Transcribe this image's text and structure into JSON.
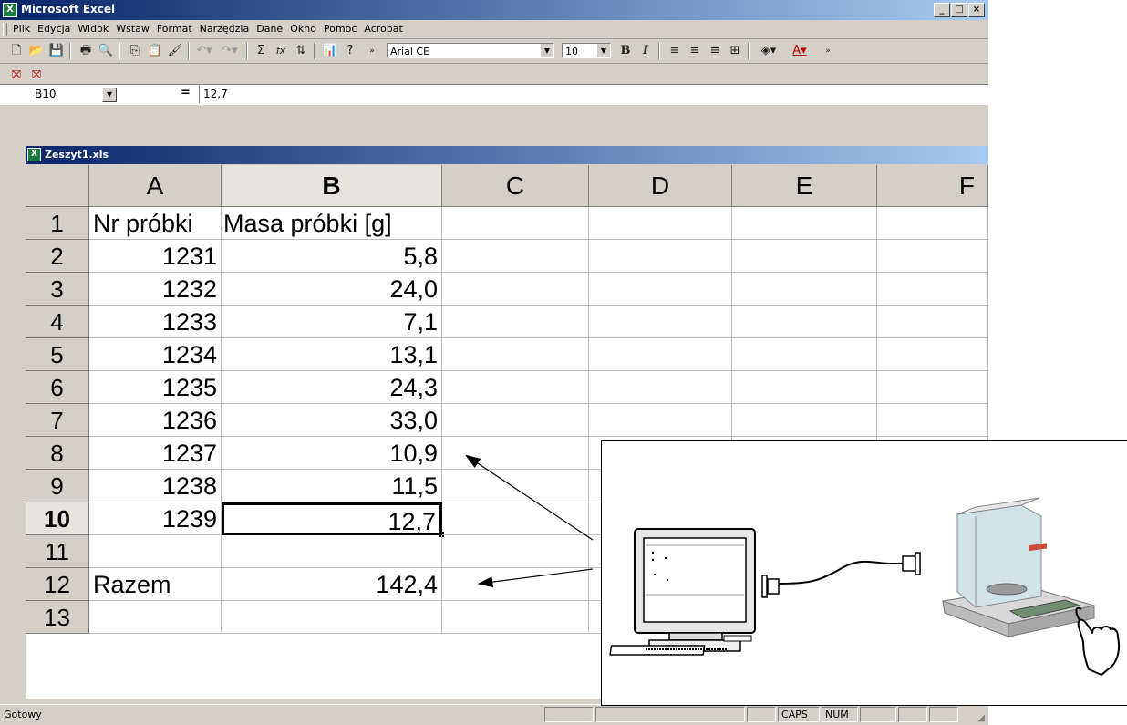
{
  "window": {
    "title": "Microsoft Excel",
    "buttons": [
      "_",
      "□",
      "×"
    ]
  },
  "menu": [
    "Plik",
    "Edycja",
    "Widok",
    "Wstaw",
    "Format",
    "Narzędzia",
    "Dane",
    "Okno",
    "Pomoc",
    "Acrobat"
  ],
  "toolbar": {
    "font_name": "Arial CE",
    "font_size": "10",
    "bold_label": "B",
    "italic_label": "I",
    "sum_label": "Σ",
    "fx_label": "fx"
  },
  "formula_bar": {
    "name_box": "B10",
    "equals": "=",
    "value": "12,7"
  },
  "workbook": {
    "title": "Zeszyt1.xls"
  },
  "sheet": {
    "columns": [
      "A",
      "B",
      "C",
      "D",
      "E",
      "F"
    ],
    "active_column": "B",
    "active_row": "10",
    "rows": [
      {
        "n": "1",
        "a": "Nr próbki",
        "b": "Masa próbki [g]"
      },
      {
        "n": "2",
        "a": "1231",
        "b": "5,8"
      },
      {
        "n": "3",
        "a": "1232",
        "b": "24,0"
      },
      {
        "n": "4",
        "a": "1233",
        "b": "7,1"
      },
      {
        "n": "5",
        "a": "1234",
        "b": "13,1"
      },
      {
        "n": "6",
        "a": "1235",
        "b": "24,3"
      },
      {
        "n": "7",
        "a": "1236",
        "b": "33,0"
      },
      {
        "n": "8",
        "a": "1237",
        "b": "10,9"
      },
      {
        "n": "9",
        "a": "1238",
        "b": "11,5"
      },
      {
        "n": "10",
        "a": "1239",
        "b": "12,7"
      },
      {
        "n": "11",
        "a": "",
        "b": ""
      },
      {
        "n": "12",
        "a": "Razem",
        "b": "142,4"
      },
      {
        "n": "13",
        "a": "",
        "b": ""
      }
    ]
  },
  "status_bar": {
    "text": "Gotowy",
    "caps": "CAPS",
    "num": "NUM"
  },
  "colors": {
    "titlebar_start": "#0a246a",
    "titlebar_end": "#a6caf0",
    "chrome": "#d4d0c8",
    "excel_icon": "#1e7a3c"
  },
  "icons": [
    "new-icon",
    "open-icon",
    "save-icon",
    "print-icon",
    "print-preview-icon",
    "copy-icon",
    "paste-icon",
    "format-painter-icon",
    "undo-icon",
    "redo-icon",
    "sum-icon",
    "function-icon",
    "sort-ascending-icon",
    "chart-wizard-icon",
    "help-icon",
    "align-left-icon",
    "center-icon",
    "align-right-icon",
    "merge-center-icon",
    "fill-color-icon",
    "font-color-icon",
    "pdf-convert-icon",
    "pdf-email-icon",
    "computer-illustration",
    "balance-scale-illustration",
    "pointing-hand-illustration"
  ]
}
